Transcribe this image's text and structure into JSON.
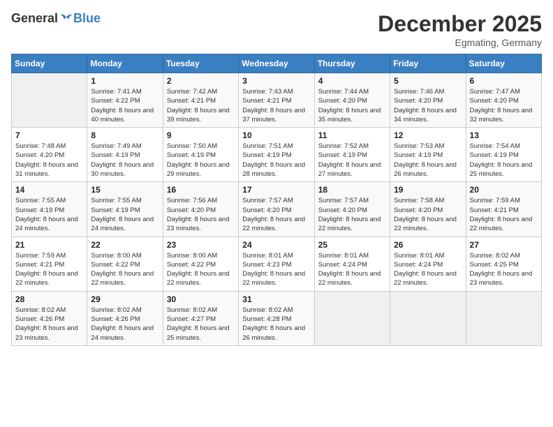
{
  "header": {
    "logo": {
      "general": "General",
      "blue": "Blue"
    },
    "title": "December 2025",
    "location": "Egmating, Germany"
  },
  "calendar": {
    "days_of_week": [
      "Sunday",
      "Monday",
      "Tuesday",
      "Wednesday",
      "Thursday",
      "Friday",
      "Saturday"
    ],
    "weeks": [
      [
        {
          "day": null
        },
        {
          "day": "1",
          "sunrise": "7:41 AM",
          "sunset": "4:22 PM",
          "daylight": "8 hours and 40 minutes."
        },
        {
          "day": "2",
          "sunrise": "7:42 AM",
          "sunset": "4:21 PM",
          "daylight": "8 hours and 39 minutes."
        },
        {
          "day": "3",
          "sunrise": "7:43 AM",
          "sunset": "4:21 PM",
          "daylight": "8 hours and 37 minutes."
        },
        {
          "day": "4",
          "sunrise": "7:44 AM",
          "sunset": "4:20 PM",
          "daylight": "8 hours and 35 minutes."
        },
        {
          "day": "5",
          "sunrise": "7:46 AM",
          "sunset": "4:20 PM",
          "daylight": "8 hours and 34 minutes."
        },
        {
          "day": "6",
          "sunrise": "7:47 AM",
          "sunset": "4:20 PM",
          "daylight": "8 hours and 32 minutes."
        }
      ],
      [
        {
          "day": "7",
          "sunrise": "7:48 AM",
          "sunset": "4:20 PM",
          "daylight": "8 hours and 31 minutes."
        },
        {
          "day": "8",
          "sunrise": "7:49 AM",
          "sunset": "4:19 PM",
          "daylight": "8 hours and 30 minutes."
        },
        {
          "day": "9",
          "sunrise": "7:50 AM",
          "sunset": "4:19 PM",
          "daylight": "8 hours and 29 minutes."
        },
        {
          "day": "10",
          "sunrise": "7:51 AM",
          "sunset": "4:19 PM",
          "daylight": "8 hours and 28 minutes."
        },
        {
          "day": "11",
          "sunrise": "7:52 AM",
          "sunset": "4:19 PM",
          "daylight": "8 hours and 27 minutes."
        },
        {
          "day": "12",
          "sunrise": "7:53 AM",
          "sunset": "4:19 PM",
          "daylight": "8 hours and 26 minutes."
        },
        {
          "day": "13",
          "sunrise": "7:54 AM",
          "sunset": "4:19 PM",
          "daylight": "8 hours and 25 minutes."
        }
      ],
      [
        {
          "day": "14",
          "sunrise": "7:55 AM",
          "sunset": "4:19 PM",
          "daylight": "8 hours and 24 minutes."
        },
        {
          "day": "15",
          "sunrise": "7:55 AM",
          "sunset": "4:19 PM",
          "daylight": "8 hours and 24 minutes."
        },
        {
          "day": "16",
          "sunrise": "7:56 AM",
          "sunset": "4:20 PM",
          "daylight": "8 hours and 23 minutes."
        },
        {
          "day": "17",
          "sunrise": "7:57 AM",
          "sunset": "4:20 PM",
          "daylight": "8 hours and 22 minutes."
        },
        {
          "day": "18",
          "sunrise": "7:57 AM",
          "sunset": "4:20 PM",
          "daylight": "8 hours and 22 minutes."
        },
        {
          "day": "19",
          "sunrise": "7:58 AM",
          "sunset": "4:20 PM",
          "daylight": "8 hours and 22 minutes."
        },
        {
          "day": "20",
          "sunrise": "7:59 AM",
          "sunset": "4:21 PM",
          "daylight": "8 hours and 22 minutes."
        }
      ],
      [
        {
          "day": "21",
          "sunrise": "7:59 AM",
          "sunset": "4:21 PM",
          "daylight": "8 hours and 22 minutes."
        },
        {
          "day": "22",
          "sunrise": "8:00 AM",
          "sunset": "4:22 PM",
          "daylight": "8 hours and 22 minutes."
        },
        {
          "day": "23",
          "sunrise": "8:00 AM",
          "sunset": "4:22 PM",
          "daylight": "8 hours and 22 minutes."
        },
        {
          "day": "24",
          "sunrise": "8:01 AM",
          "sunset": "4:23 PM",
          "daylight": "8 hours and 22 minutes."
        },
        {
          "day": "25",
          "sunrise": "8:01 AM",
          "sunset": "4:24 PM",
          "daylight": "8 hours and 22 minutes."
        },
        {
          "day": "26",
          "sunrise": "8:01 AM",
          "sunset": "4:24 PM",
          "daylight": "8 hours and 22 minutes."
        },
        {
          "day": "27",
          "sunrise": "8:02 AM",
          "sunset": "4:25 PM",
          "daylight": "8 hours and 23 minutes."
        }
      ],
      [
        {
          "day": "28",
          "sunrise": "8:02 AM",
          "sunset": "4:26 PM",
          "daylight": "8 hours and 23 minutes."
        },
        {
          "day": "29",
          "sunrise": "8:02 AM",
          "sunset": "4:26 PM",
          "daylight": "8 hours and 24 minutes."
        },
        {
          "day": "30",
          "sunrise": "8:02 AM",
          "sunset": "4:27 PM",
          "daylight": "8 hours and 25 minutes."
        },
        {
          "day": "31",
          "sunrise": "8:02 AM",
          "sunset": "4:28 PM",
          "daylight": "8 hours and 26 minutes."
        },
        {
          "day": null
        },
        {
          "day": null
        },
        {
          "day": null
        }
      ]
    ]
  }
}
